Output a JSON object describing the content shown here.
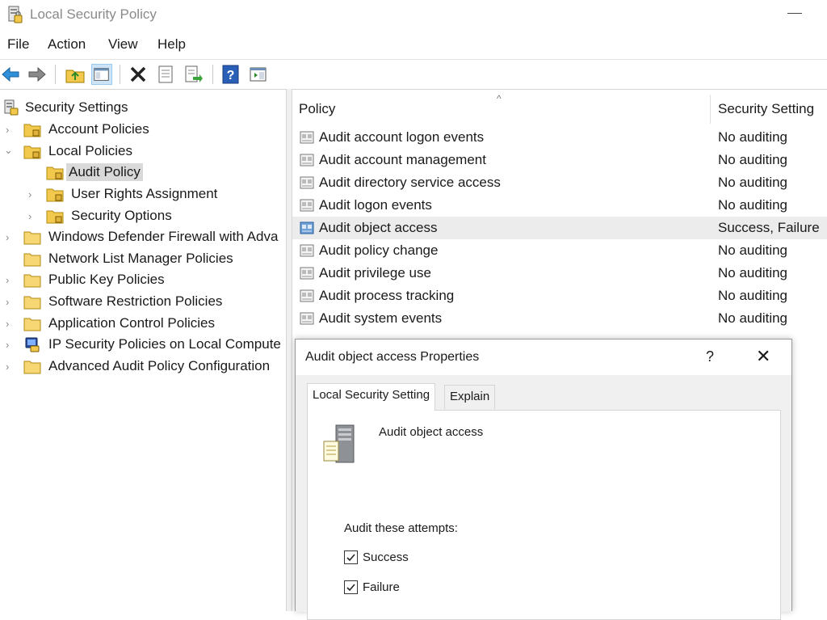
{
  "window": {
    "title": "Local Security Policy"
  },
  "menu": [
    "File",
    "Action",
    "View",
    "Help"
  ],
  "toolbar": {
    "icons": [
      "back-icon",
      "forward-icon",
      "up-folder-icon",
      "show-hide-tree-icon",
      "delete-icon",
      "properties-icon",
      "export-list-icon",
      "help-icon",
      "action-pane-icon"
    ]
  },
  "tree": {
    "root": "Security Settings",
    "items": [
      {
        "label": "Account Policies"
      },
      {
        "label": "Local Policies"
      },
      {
        "label": "Audit Policy"
      },
      {
        "label": "User Rights Assignment"
      },
      {
        "label": "Security Options"
      },
      {
        "label": "Windows Defender Firewall with Adva"
      },
      {
        "label": "Network List Manager Policies"
      },
      {
        "label": "Public Key Policies"
      },
      {
        "label": "Software Restriction Policies"
      },
      {
        "label": "Application Control Policies"
      },
      {
        "label": "IP Security Policies on Local Compute"
      },
      {
        "label": "Advanced Audit Policy Configuration"
      }
    ]
  },
  "list": {
    "columns": {
      "policy": "Policy",
      "setting": "Security Setting"
    },
    "rows": [
      {
        "name": "Audit account logon events",
        "value": "No auditing"
      },
      {
        "name": "Audit account management",
        "value": "No auditing"
      },
      {
        "name": "Audit directory service access",
        "value": "No auditing"
      },
      {
        "name": "Audit logon events",
        "value": "No auditing"
      },
      {
        "name": "Audit object access",
        "value": "Success, Failure"
      },
      {
        "name": "Audit policy change",
        "value": "No auditing"
      },
      {
        "name": "Audit privilege use",
        "value": "No auditing"
      },
      {
        "name": "Audit process tracking",
        "value": "No auditing"
      },
      {
        "name": "Audit system events",
        "value": "No auditing"
      }
    ]
  },
  "dialog": {
    "title": "Audit object access Properties",
    "help": "?",
    "close": "✕",
    "tabs": [
      "Local Security Setting",
      "Explain"
    ],
    "policy_name": "Audit object access",
    "attempts_label": "Audit these attempts:",
    "success_label": "Success",
    "failure_label": "Failure",
    "success_checked": true,
    "failure_checked": true
  },
  "colors": {
    "selection": "#d9d9d9",
    "highlight_row": "#ececec",
    "folder": "#f2c94c",
    "accent_blue": "#1e73be"
  }
}
